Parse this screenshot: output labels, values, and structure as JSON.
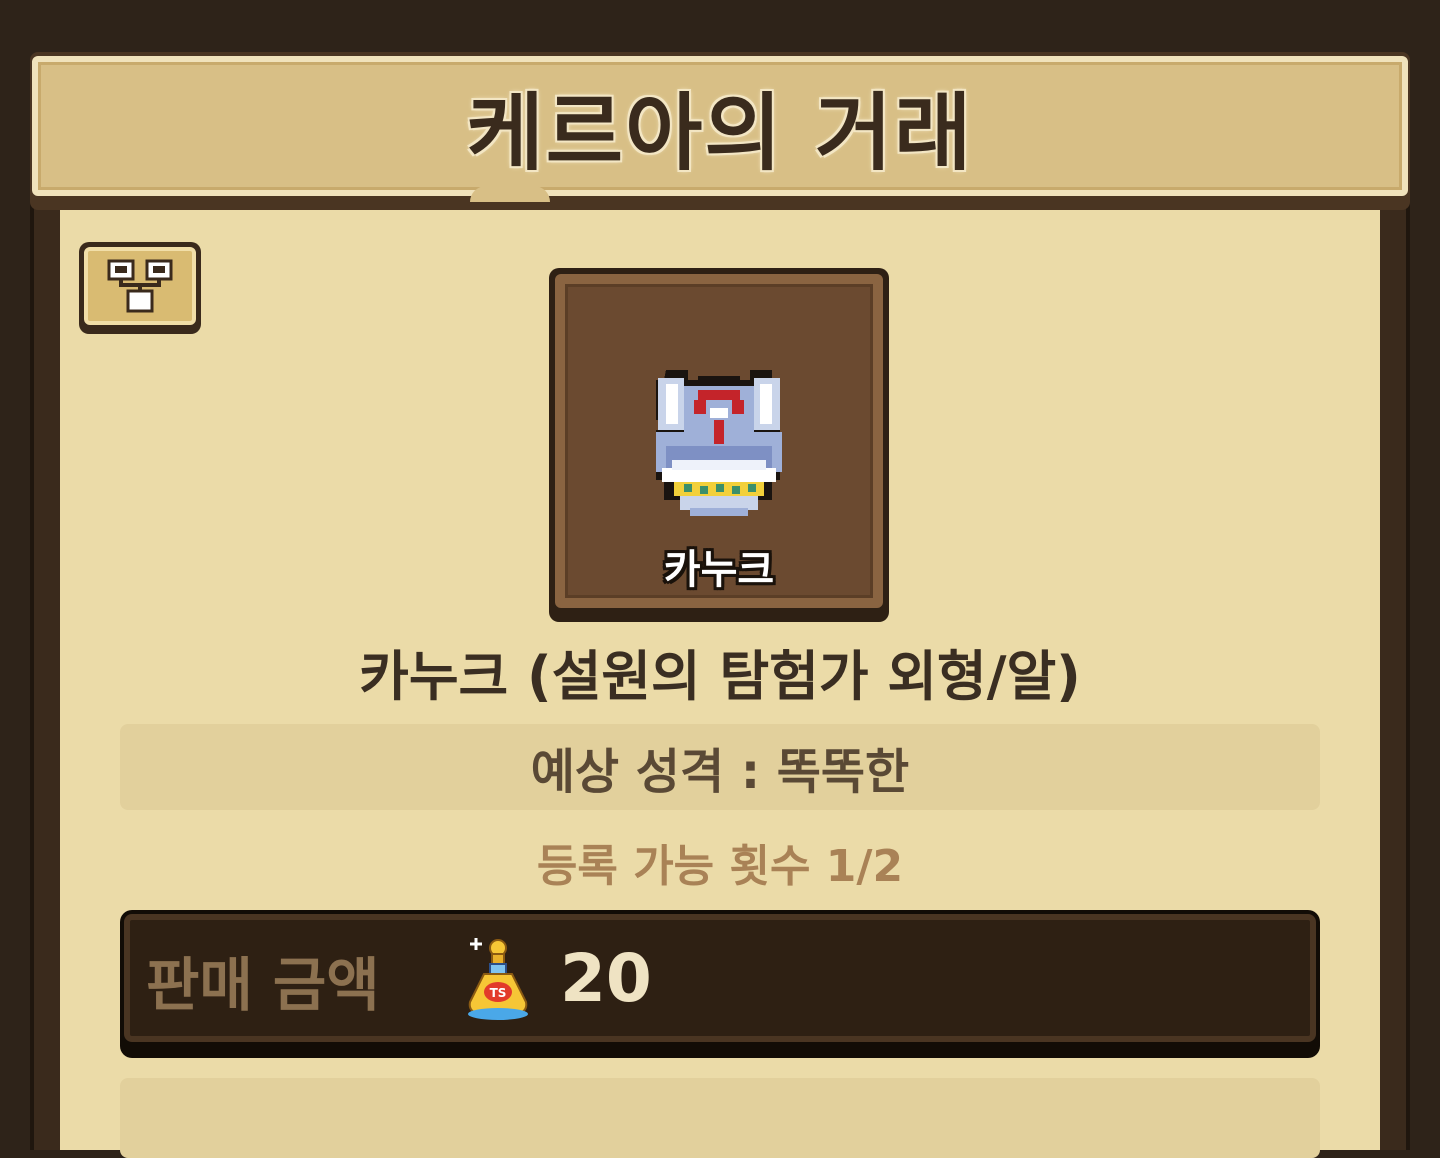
{
  "header": {
    "title": "케르아의 거래"
  },
  "toolbar": {
    "tree_icon": "hierarchy-icon"
  },
  "item": {
    "portrait_label": "카누크",
    "icon": "armored-helmet-icon",
    "name": "카누크 (설원의 탐험가 외형/알)",
    "personality": "예상 성격 : 똑똑한",
    "registration": "등록 가능 횟수 1/2"
  },
  "price": {
    "label": "판매 금액",
    "currency_icon": "potion-bottle-icon",
    "value": "20"
  },
  "colors": {
    "panel_background": "#ebdba8",
    "banner": "#d8bf86",
    "wood_dark": "#2e2319",
    "price_panel": "#2e2013"
  }
}
